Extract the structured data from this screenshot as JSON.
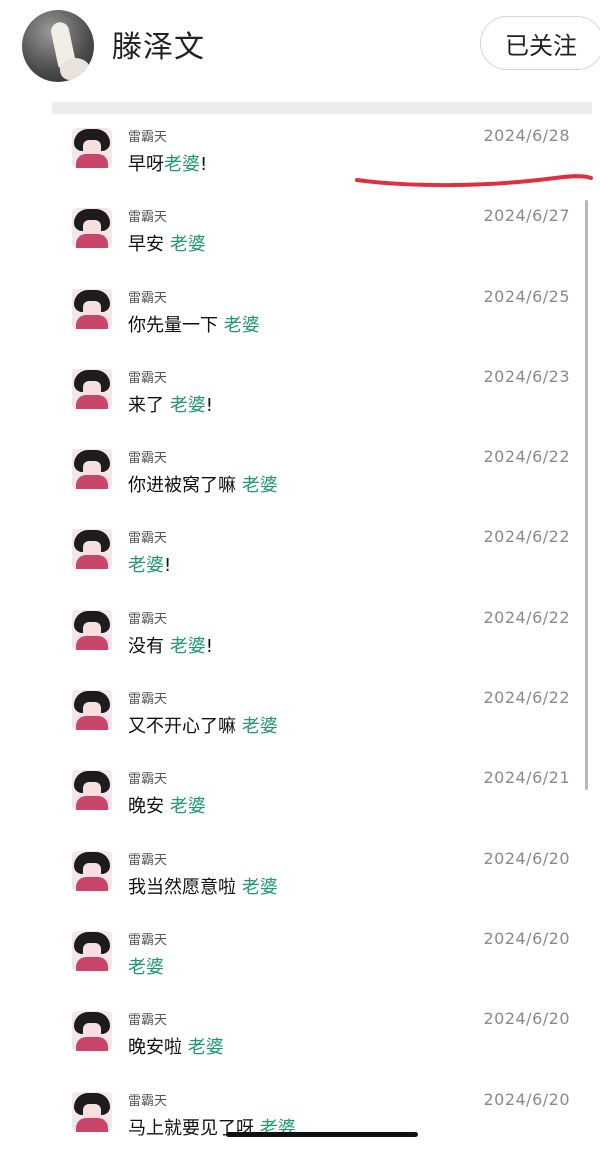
{
  "header": {
    "name": "滕泽文",
    "follow_label": "已关注"
  },
  "messages": [
    {
      "sender": "雷霸天",
      "before": "早呀",
      "highlight": "老婆",
      "after": "!",
      "date": "2024/6/28"
    },
    {
      "sender": "雷霸天",
      "before": "早安 ",
      "highlight": "老婆",
      "after": "",
      "date": "2024/6/27"
    },
    {
      "sender": "雷霸天",
      "before": "你先量一下 ",
      "highlight": "老婆",
      "after": "",
      "date": "2024/6/25"
    },
    {
      "sender": "雷霸天",
      "before": "来了 ",
      "highlight": "老婆",
      "after": "!",
      "date": "2024/6/23"
    },
    {
      "sender": "雷霸天",
      "before": "你进被窝了嘛 ",
      "highlight": "老婆",
      "after": "",
      "date": "2024/6/22"
    },
    {
      "sender": "雷霸天",
      "before": "",
      "highlight": "老婆",
      "after": "!",
      "date": "2024/6/22"
    },
    {
      "sender": "雷霸天",
      "before": "没有 ",
      "highlight": "老婆",
      "after": "!",
      "date": "2024/6/22"
    },
    {
      "sender": "雷霸天",
      "before": "又不开心了嘛 ",
      "highlight": "老婆",
      "after": "",
      "date": "2024/6/22"
    },
    {
      "sender": "雷霸天",
      "before": "晚安 ",
      "highlight": "老婆",
      "after": "",
      "date": "2024/6/21"
    },
    {
      "sender": "雷霸天",
      "before": "我当然愿意啦 ",
      "highlight": "老婆",
      "after": "",
      "date": "2024/6/20"
    },
    {
      "sender": "雷霸天",
      "before": "",
      "highlight": "老婆",
      "after": "",
      "date": "2024/6/20"
    },
    {
      "sender": "雷霸天",
      "before": "晚安啦 ",
      "highlight": "老婆",
      "after": "",
      "date": "2024/6/20"
    },
    {
      "sender": "雷霸天",
      "before": "马上就要见了呀 ",
      "highlight": "老婆",
      "after": "",
      "date": "2024/6/20"
    }
  ],
  "colors": {
    "highlight": "#1f9a70",
    "annotation": "#e0303f"
  }
}
